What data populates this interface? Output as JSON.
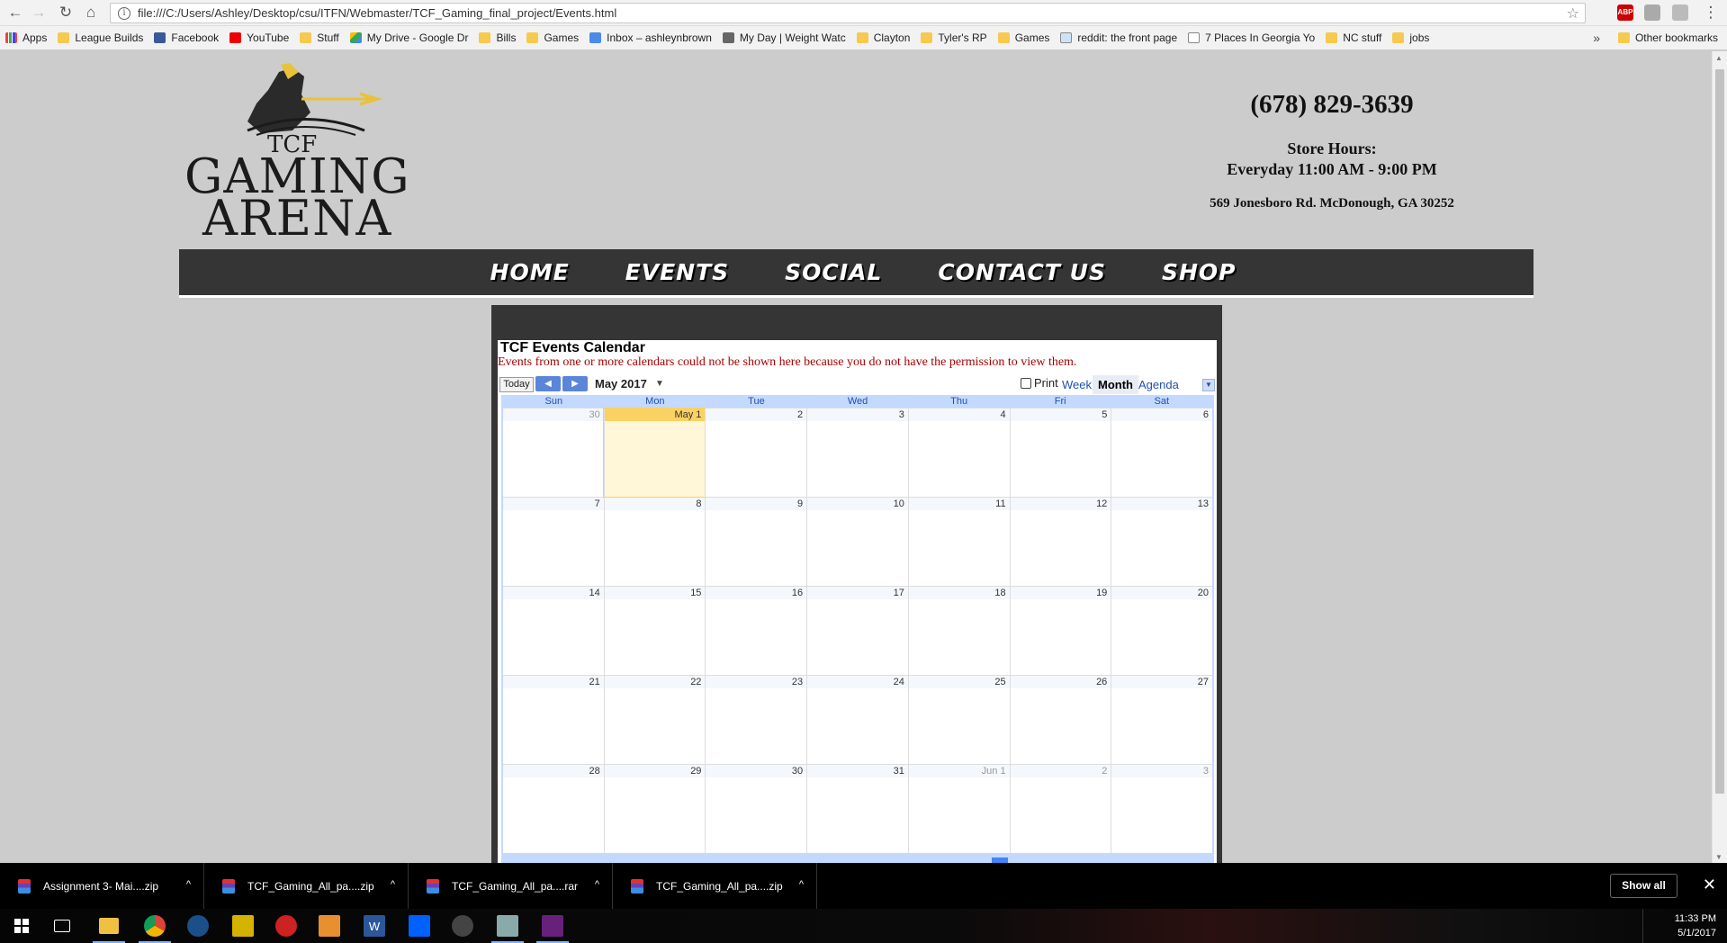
{
  "browser": {
    "url": "file:///C:/Users/Ashley/Desktop/csu/ITFN/Webmaster/TCF_Gaming_final_project/Events.html",
    "bookmarks": [
      "Apps",
      "League Builds",
      "Facebook",
      "YouTube",
      "Stuff",
      "My Drive - Google Dr",
      "Bills",
      "Games",
      "Inbox – ashleynbrown",
      "My Day | Weight Watc",
      "Clayton",
      "Tyler's RP",
      "Games",
      "reddit: the front page",
      "7 Places In Georgia Yo",
      "NC stuff",
      "jobs"
    ],
    "bookmarks_more": "»",
    "other_bookmarks": "Other bookmarks",
    "extensions": [
      "ABP"
    ]
  },
  "site": {
    "logo": {
      "tcf": "TCF",
      "gaming": "GAMING",
      "arena": "ARENA"
    },
    "phone": "(678) 829-3639",
    "hours_label": "Store Hours:",
    "hours": "Everyday 11:00 AM - 9:00 PM",
    "address": "569 Jonesboro Rd. McDonough, GA 30252",
    "nav": [
      "HOME",
      "EVENTS",
      "SOCIAL",
      "CONTACT US",
      "SHOP"
    ]
  },
  "calendar": {
    "title": "TCF Events Calendar",
    "warning": "Events from one or more calendars could not be shown here because you do not have the permission to view them.",
    "today_label": "Today",
    "month_label": "May 2017",
    "print_label": "Print",
    "tabs": [
      "Week",
      "Month",
      "Agenda"
    ],
    "active_tab": "Month",
    "days_of_week": [
      "Sun",
      "Mon",
      "Tue",
      "Wed",
      "Thu",
      "Fri",
      "Sat"
    ],
    "weeks": [
      [
        "30",
        "May 1",
        "2",
        "3",
        "4",
        "5",
        "6"
      ],
      [
        "7",
        "8",
        "9",
        "10",
        "11",
        "12",
        "13"
      ],
      [
        "14",
        "15",
        "16",
        "17",
        "18",
        "19",
        "20"
      ],
      [
        "21",
        "22",
        "23",
        "24",
        "25",
        "26",
        "27"
      ],
      [
        "28",
        "29",
        "30",
        "31",
        "Jun 1",
        "2",
        "3"
      ]
    ]
  },
  "downloads": {
    "items": [
      "Assignment 3- Mai....zip",
      "TCF_Gaming_All_pa....zip",
      "TCF_Gaming_All_pa....rar",
      "TCF_Gaming_All_pa....zip"
    ],
    "show_all": "Show all"
  },
  "taskbar": {
    "time": "11:33 PM",
    "date": "5/1/2017"
  },
  "colors": {
    "page_bg": "#cccccc",
    "nav_bg": "#353535",
    "today_highlight": "#fad163",
    "calendar_header": "#c3d9ff",
    "warning_text": "#aa0000"
  }
}
